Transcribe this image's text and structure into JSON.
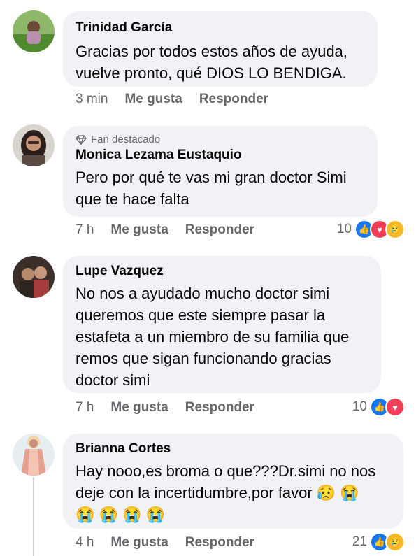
{
  "comments": [
    {
      "name": "Trinidad García",
      "badge": "",
      "text": "Gracias por todos estos años de ayuda,\nvuelve pronto, qué DIOS LO BENDIGA.",
      "time": "3 min",
      "like": "Me gusta",
      "reply": "Responder",
      "reactions": "",
      "avatar": "avatar-photo"
    },
    {
      "name": "Monica Lezama Eustaquio",
      "badge": "Fan destacado",
      "text": "Pero por qué te vas mi gran doctor Simi\nque te hace falta",
      "time": "7 h",
      "like": "Me gusta",
      "reply": "Responder",
      "reactions": "10",
      "avatar": "avatar-photo"
    },
    {
      "name": "Lupe Vazquez",
      "badge": "",
      "text": "No nos a ayudado mucho doctor simi\nqueremos que este siempre pasar la\nestafeta a un miembro de su familia que\nremos que sigan funcionando gracias\ndoctor simi",
      "time": "7 h",
      "like": "Me gusta",
      "reply": "Responder",
      "reactions": "10",
      "avatar": "avatar-photo"
    },
    {
      "name": "Brianna Cortes",
      "badge": "",
      "text": "Hay nooo,es broma o que???Dr.simi no nos\ndeje con la incertidumbre,por favor 😥 😭\n😭 😭 😭 😭",
      "time": "4 h",
      "like": "Me gusta",
      "reply": "Responder",
      "reactions": "21",
      "avatar": "avatar-photo"
    }
  ],
  "colors": {
    "bubble": "#f0f2f5",
    "meta": "#65676b",
    "like": "#1877f2",
    "love": "#f33e58",
    "sad": "#f7b928"
  },
  "icons": [
    "diamond-icon",
    "like-reaction-icon",
    "love-reaction-icon",
    "sad-reaction-icon"
  ]
}
